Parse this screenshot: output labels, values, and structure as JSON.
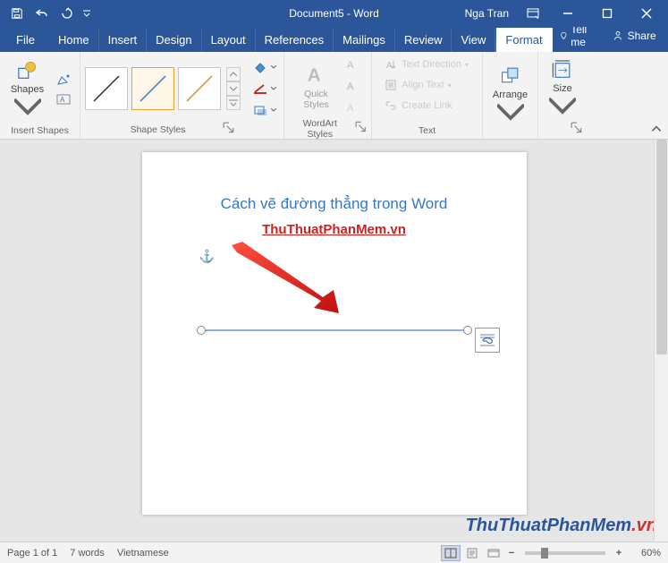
{
  "titlebar": {
    "doc_title": "Document5 - Word",
    "user": "Nga Tran"
  },
  "tabs": {
    "file": "File",
    "home": "Home",
    "insert": "Insert",
    "design": "Design",
    "layout": "Layout",
    "references": "References",
    "mailings": "Mailings",
    "review": "Review",
    "view": "View",
    "format": "Format",
    "tellme": "Tell me",
    "share": "Share"
  },
  "ribbon": {
    "insert_shapes": {
      "shapes_btn": "Shapes",
      "group_label": "Insert Shapes"
    },
    "shape_styles": {
      "group_label": "Shape Styles"
    },
    "wordart": {
      "quick_styles": "Quick Styles",
      "group_label": "WordArt Styles"
    },
    "text": {
      "direction": "Text Direction",
      "align": "Align Text",
      "link": "Create Link",
      "group_label": "Text"
    },
    "arrange": {
      "btn": "Arrange",
      "group_label": ""
    },
    "size": {
      "btn": "Size",
      "group_label": ""
    }
  },
  "document": {
    "heading": "Cách vẽ đường thẳng trong Word",
    "link_text": "ThuThuatPhanMem.vn"
  },
  "watermark": {
    "blue": "ThuThuatPhanMem",
    "red": ".vn"
  },
  "statusbar": {
    "page": "Page 1 of 1",
    "words": "7 words",
    "lang": "Vietnamese",
    "zoom": "60%"
  }
}
